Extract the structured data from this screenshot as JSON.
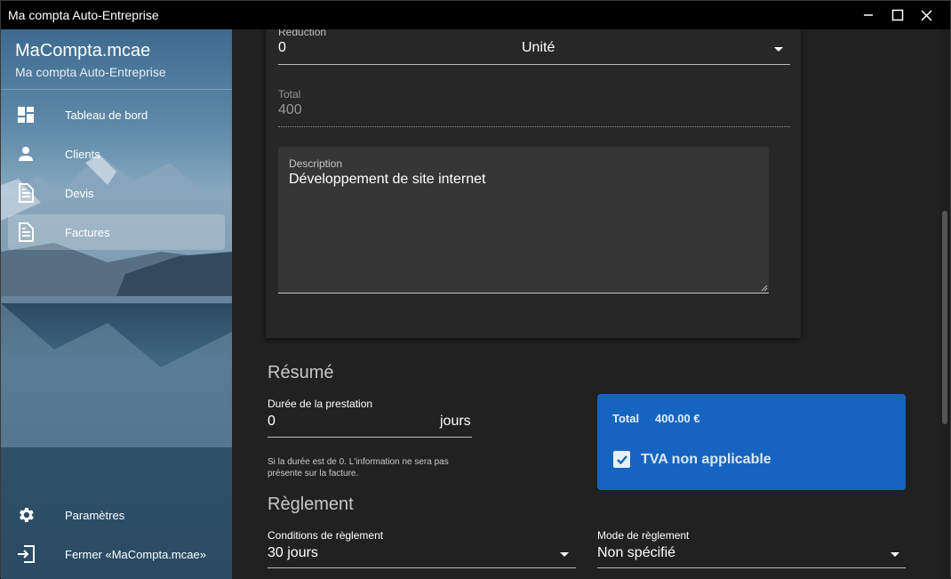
{
  "window": {
    "title": "Ma compta Auto-Entreprise",
    "controls": [
      "minimize-icon",
      "maximize-icon",
      "close-icon"
    ]
  },
  "sidebar": {
    "brand_title": "MaCompta.mcae",
    "brand_subtitle": "Ma compta Auto-Entreprise",
    "items": [
      {
        "label": "Tableau de bord",
        "icon": "dashboard-icon",
        "active": false
      },
      {
        "label": "Clients",
        "icon": "person-icon",
        "active": false
      },
      {
        "label": "Devis",
        "icon": "document-icon",
        "active": false
      },
      {
        "label": "Factures",
        "icon": "document-icon",
        "active": true
      }
    ],
    "bottom_items": [
      {
        "label": "Paramètres",
        "icon": "gear-icon"
      },
      {
        "label": "Fermer «MaCompta.mcae»",
        "icon": "exit-icon"
      }
    ]
  },
  "line_item": {
    "reduction_label": "Réduction",
    "reduction_value": "0",
    "unit_value": "Unité",
    "total_label": "Total",
    "total_value": "400",
    "description_label": "Description",
    "description_value": "Développement de site internet"
  },
  "summary": {
    "title": "Résumé",
    "duration_label": "Durée de la prestation",
    "duration_value": "0",
    "duration_unit": "jours",
    "duration_hint": "Si la durée est de 0. L'information ne sera pas présente sur la facture.",
    "total_label": "Total",
    "total_value": "400.00 €",
    "tva_label": "TVA non applicable",
    "tva_checked": true
  },
  "payment": {
    "title": "Règlement",
    "conditions_label": "Conditions de règlement",
    "conditions_value": "30 jours",
    "mode_label": "Mode de règlement",
    "mode_value": "Non spécifié"
  },
  "colors": {
    "accent": "#1565c0",
    "background": "#212121",
    "card": "#272727"
  }
}
